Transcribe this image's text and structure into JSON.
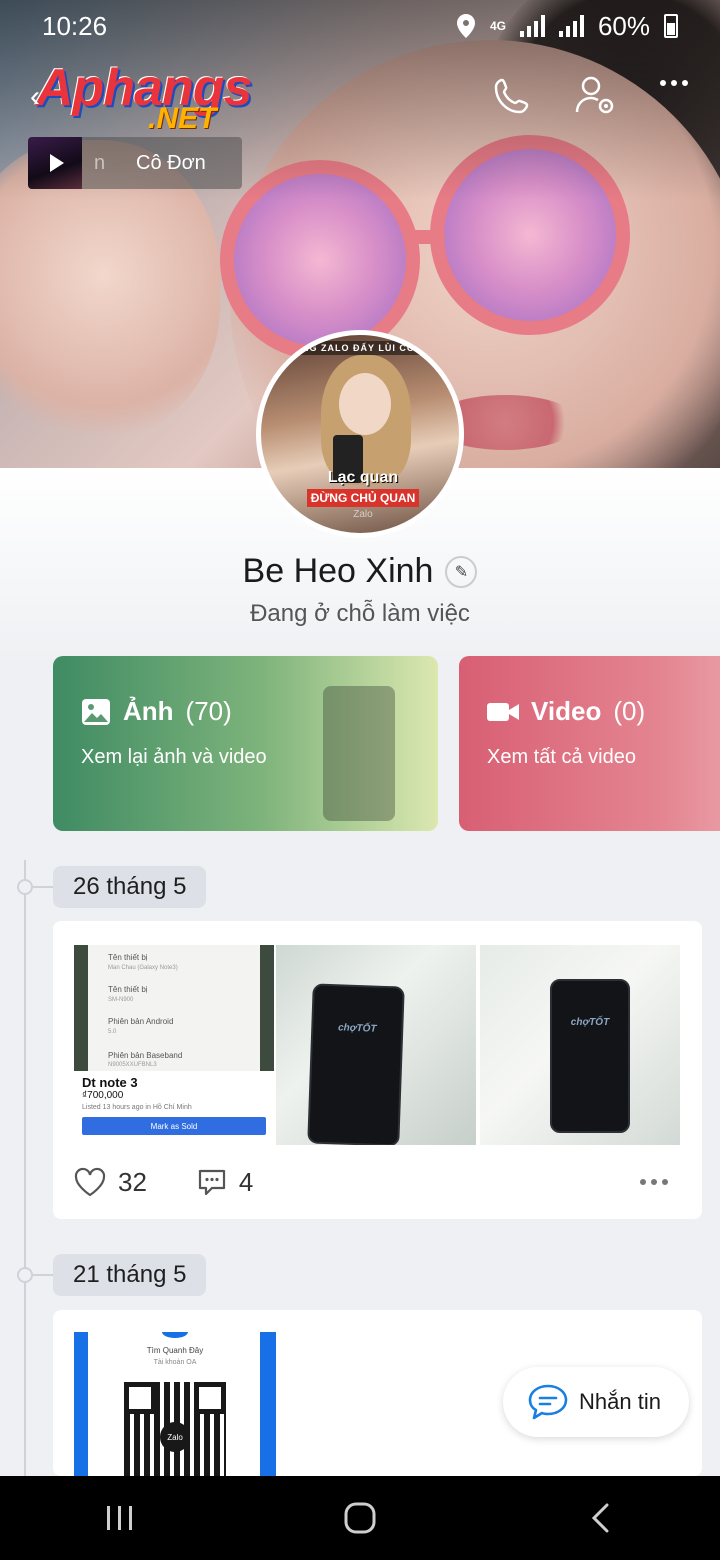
{
  "status_bar": {
    "time": "10:26",
    "network": "4G",
    "battery": "60%"
  },
  "header": {
    "logo_main": "Aphangs",
    "logo_sub": ".NET",
    "icons": [
      "back-icon",
      "phone-icon",
      "user-settings-icon",
      "more-icon"
    ]
  },
  "music": {
    "track_fragment": "n",
    "track_title": "Cô Đơn"
  },
  "avatar": {
    "ring_text": "CÙNG ZALO ĐẨY LÙI COVID",
    "banner_line1": "Lạc quan",
    "banner_line2": "ĐỪNG CHỦ QUAN",
    "banner_line3": "Zalo"
  },
  "profile": {
    "name": "Be Heo Xinh",
    "status": "Đang ở chỗ làm việc"
  },
  "cards": {
    "photos": {
      "title": "Ảnh",
      "count": "(70)",
      "subtitle": "Xem lại ảnh và video",
      "color": "#3f8b63"
    },
    "videos": {
      "title": "Video",
      "count": "(0)",
      "subtitle": "Xem tất cả video",
      "color": "#d85f73"
    }
  },
  "posts": [
    {
      "date": "26 tháng 5",
      "likes": "32",
      "comments": "4",
      "photo1": {
        "rows": [
          "Tên thiết bị",
          "Tên thiết bị",
          "Phiên bản Android",
          "Phiên bản Baseband"
        ],
        "row_values": [
          "Man Chau (Galaxy Note3)",
          "SM-N900",
          "5.0",
          "N9005XXUFBNL3"
        ],
        "item_title": "Dt note 3",
        "item_price": "₫700,000",
        "item_listed": "Listed 13 hours ago in Hồ Chí Minh",
        "item_button": "Mark as Sold"
      },
      "photo_brand": "chợTỐT"
    },
    {
      "date": "21 tháng 5",
      "qr_name": "Tìm Quanh Đây",
      "qr_sub": "Tài khoản OA",
      "qr_logo": "Zalo"
    }
  ],
  "message_button": {
    "label": "Nhắn tin"
  }
}
